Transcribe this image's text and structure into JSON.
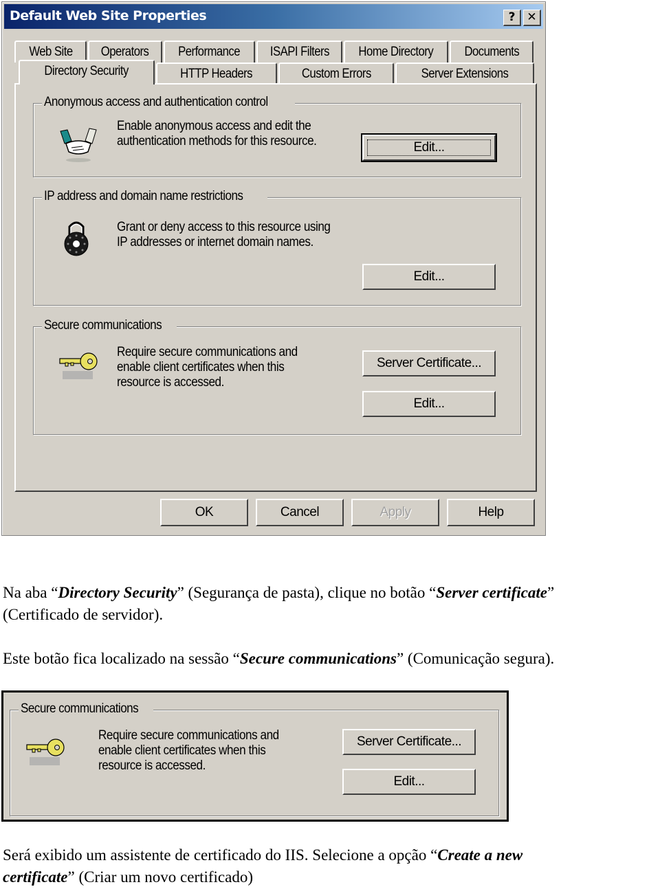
{
  "dialog": {
    "title": "Default Web Site Properties",
    "title_buttons": [
      {
        "icon": "help-icon",
        "glyph": "?"
      },
      {
        "icon": "close-icon",
        "glyph": "✕"
      }
    ],
    "tabs_row_back": [
      "Web Site",
      "Operators",
      "Performance",
      "ISAPI Filters",
      "Home Directory",
      "Documents"
    ],
    "tabs_row_front": [
      "Directory Security",
      "HTTP Headers",
      "Custom Errors",
      "Server Extensions"
    ],
    "active_tab": "Directory Security",
    "groups": [
      {
        "label": "Anonymous access and authentication control",
        "icon": "handshake-icon",
        "description": [
          "Enable anonymous access and edit the",
          "authentication methods for this resource."
        ],
        "buttons": [
          "Edit..."
        ]
      },
      {
        "label": "IP address and domain name restrictions",
        "icon": "padlock-icon",
        "description": [
          "Grant or deny access to this resource using",
          "IP addresses or internet domain names."
        ],
        "buttons": [
          "Edit..."
        ]
      },
      {
        "label": "Secure communications",
        "icon": "key-icon",
        "description": [
          "Require secure communications and",
          "enable client certificates when this",
          "resource is accessed."
        ],
        "buttons": [
          "Server Certificate...",
          "Edit..."
        ]
      }
    ],
    "footer_buttons": [
      {
        "label": "OK",
        "enabled": true
      },
      {
        "label": "Cancel",
        "enabled": true
      },
      {
        "label": "Apply",
        "enabled": false
      },
      {
        "label": "Help",
        "enabled": true
      }
    ],
    "colors": {
      "face": "#d4d0c8",
      "title_start": "#0a246a",
      "title_end": "#a6caf0",
      "key_yellow": "#e8e060",
      "handshake_teal": "#1a8a8a"
    }
  },
  "text": {
    "p1": {
      "a": "Na aba “",
      "b": "Directory Security",
      "c": "” (Segurança de pasta), clique no botão “",
      "d": "Server certificate",
      "e": "”",
      "line2": "(Certificado de servidor)."
    },
    "p2": {
      "a": "Este botão fica localizado na sessão “",
      "b": "Secure communications",
      "c": "” (Comunicação segura)."
    },
    "p3": {
      "a": "Será exibido um assistente de certificado do IIS. Selecione a opção “",
      "b": "Create a new",
      "c": "certificate",
      "d": "” (Criar um novo certificado)"
    }
  },
  "crop": {
    "label": "Secure communications",
    "description": [
      "Require secure communications and",
      "enable client certificates when this",
      "resource is accessed."
    ],
    "buttons": [
      "Server Certificate...",
      "Edit..."
    ]
  }
}
